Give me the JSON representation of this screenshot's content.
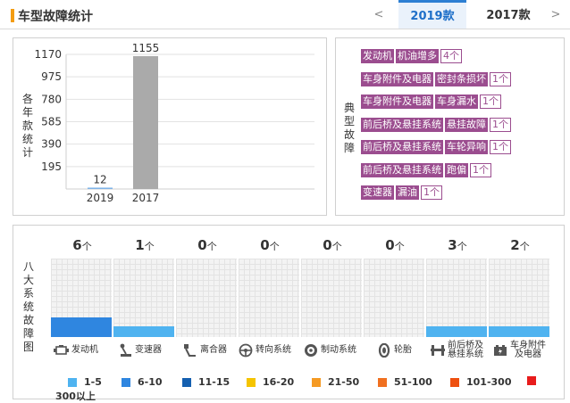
{
  "header": {
    "title": "车型故障统计",
    "prev_label": "<",
    "next_label": ">",
    "tabs": [
      {
        "label": "2019款",
        "active": true
      },
      {
        "label": "2017款",
        "active": false
      }
    ]
  },
  "year_chart": {
    "ylabel": "各年款统计",
    "chart_data": {
      "type": "bar",
      "categories": [
        "2019",
        "2017"
      ],
      "values": [
        12,
        1155
      ],
      "ylabel": "各年款统计",
      "yticks": [
        195,
        390,
        585,
        780,
        975,
        1170
      ],
      "ylim": [
        0,
        1170
      ],
      "grid": true,
      "colors": {
        "2019": "#7fb3e8",
        "2017": "#aaaaaa"
      }
    }
  },
  "typical_faults": {
    "label": "典型故障",
    "items": [
      {
        "system": "发动机",
        "part": "机油增多",
        "count": "4个"
      },
      {
        "system": "车身附件及电器",
        "part": "密封条损坏",
        "count": "1个"
      },
      {
        "system": "车身附件及电器",
        "part": "车身漏水",
        "count": "1个"
      },
      {
        "system": "前后桥及悬挂系统",
        "part": "悬挂故障",
        "count": "1个"
      },
      {
        "system": "前后桥及悬挂系统",
        "part": "车轮异响",
        "count": "1个"
      },
      {
        "system": "前后桥及悬挂系统",
        "part": "跑偏",
        "count": "1个"
      },
      {
        "system": "变速器",
        "part": "漏油",
        "count": "1个"
      }
    ]
  },
  "eight_systems": {
    "ylabel": "八大系统故障图",
    "unit": "个",
    "chart_data": {
      "type": "bar",
      "categories": [
        "发动机",
        "变速器",
        "离合器",
        "转向系统",
        "制动系统",
        "轮胎",
        "前后桥及悬挂系统",
        "车身附件及电器"
      ],
      "values": [
        6,
        1,
        0,
        0,
        0,
        0,
        3,
        2
      ]
    },
    "systems": [
      {
        "count": "6",
        "label": "发动机",
        "icon": "engine-icon"
      },
      {
        "count": "1",
        "label": "变速器",
        "icon": "gear-shifter-icon"
      },
      {
        "count": "0",
        "label": "离合器",
        "icon": "clutch-pedal-icon"
      },
      {
        "count": "0",
        "label": "转向系统",
        "icon": "steering-wheel-icon"
      },
      {
        "count": "0",
        "label": "制动系统",
        "icon": "brake-disc-icon"
      },
      {
        "count": "0",
        "label": "轮胎",
        "icon": "tire-icon"
      },
      {
        "count": "3",
        "label": "前后桥及\n悬挂系统",
        "icon": "suspension-icon"
      },
      {
        "count": "2",
        "label": "车身附件\n及电器",
        "icon": "car-battery-icon"
      }
    ],
    "legend": [
      {
        "label": "1-5",
        "color": "#4fb3f0"
      },
      {
        "label": "6-10",
        "color": "#2f86e0"
      },
      {
        "label": "11-15",
        "color": "#1560b0"
      },
      {
        "label": "16-20",
        "color": "#f5c400"
      },
      {
        "label": "21-50",
        "color": "#f59a23"
      },
      {
        "label": "51-100",
        "color": "#f07020"
      },
      {
        "label": "101-300",
        "color": "#ee5010"
      },
      {
        "label": "300以上",
        "color": "#e81c1c"
      }
    ]
  }
}
